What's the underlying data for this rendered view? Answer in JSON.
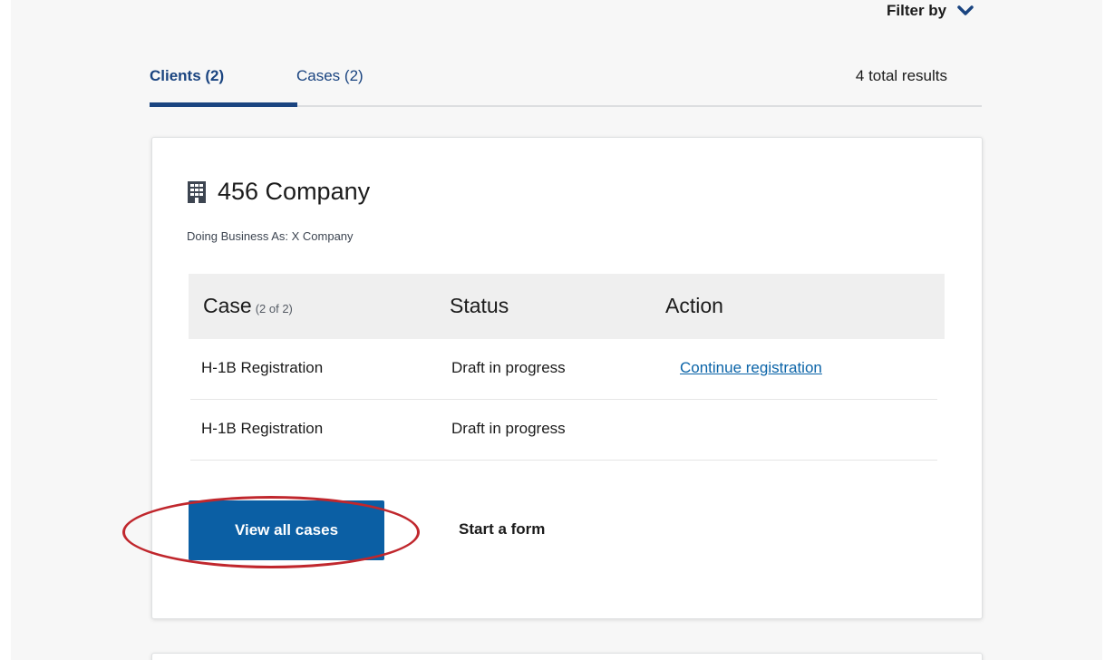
{
  "header": {
    "filter_label": "Filter by"
  },
  "tabs": [
    {
      "label": "Clients (2)",
      "active": true
    },
    {
      "label": "Cases (2)",
      "active": false
    }
  ],
  "results": {
    "total_label": "4 total results"
  },
  "client_card": {
    "company_icon": "building-icon",
    "company_name": "456 Company",
    "dba": "Doing Business As: X Company",
    "table": {
      "headers": {
        "case": "Case",
        "case_count": "(2 of 2)",
        "status": "Status",
        "action": "Action"
      },
      "rows": [
        {
          "case": "H-1B Registration",
          "status": "Draft in progress",
          "action": "Continue registration"
        },
        {
          "case": "H-1B Registration",
          "status": "Draft in progress",
          "action": ""
        }
      ]
    },
    "view_all_label": "View all cases",
    "start_form_label": "Start a form"
  },
  "colors": {
    "primary_button": "#0b5fa4",
    "tab_active": "#1a4480",
    "link": "#0b64a8",
    "highlight": "#c0272d"
  }
}
